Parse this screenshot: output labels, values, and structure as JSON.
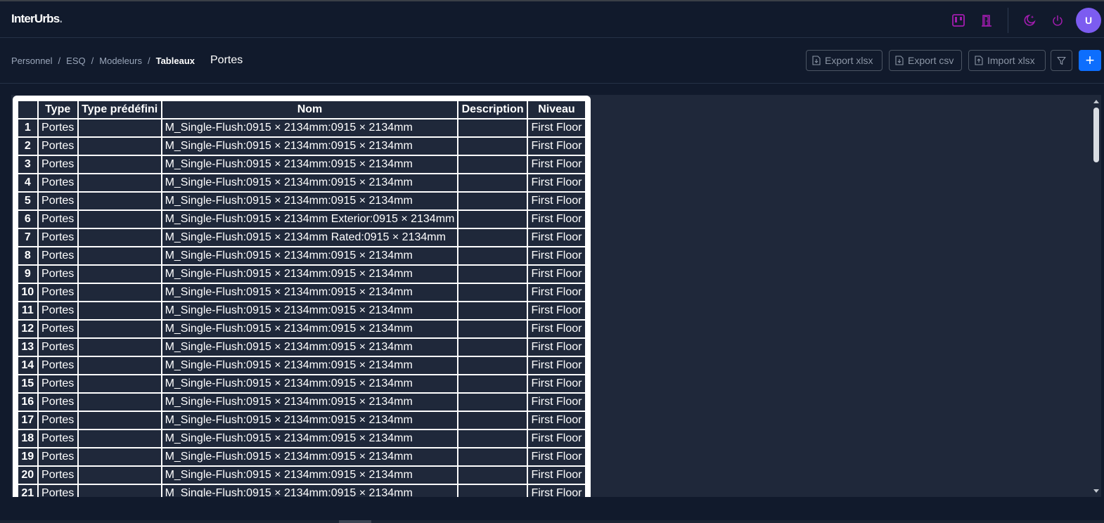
{
  "app": {
    "logo_main": "InterUrbs",
    "logo_dot": "."
  },
  "navbar": {
    "icons": [
      "kanban-icon",
      "door-icon",
      "moon-star-icon",
      "power-icon"
    ],
    "avatar_initial": "U",
    "accent_color": "#a21caf",
    "avatar_color": "#7c5cf0"
  },
  "breadcrumb": {
    "items": [
      "Personnel",
      "ESQ",
      "Modeleurs"
    ],
    "current": "Tableaux"
  },
  "page": {
    "title": "Portes"
  },
  "toolbar": {
    "export_xlsx": "Export xlsx",
    "export_csv": "Export csv",
    "import_xlsx": "Import xlsx",
    "add_label": "+"
  },
  "table": {
    "columns": [
      "",
      "Type",
      "Type prédéfini",
      "Nom",
      "Description",
      "Niveau"
    ],
    "rows": [
      [
        "1",
        "Portes",
        "",
        "M_Single-Flush:0915 × 2134mm:0915 × 2134mm",
        "",
        "First Floor"
      ],
      [
        "2",
        "Portes",
        "",
        "M_Single-Flush:0915 × 2134mm:0915 × 2134mm",
        "",
        "First Floor"
      ],
      [
        "3",
        "Portes",
        "",
        "M_Single-Flush:0915 × 2134mm:0915 × 2134mm",
        "",
        "First Floor"
      ],
      [
        "4",
        "Portes",
        "",
        "M_Single-Flush:0915 × 2134mm:0915 × 2134mm",
        "",
        "First Floor"
      ],
      [
        "5",
        "Portes",
        "",
        "M_Single-Flush:0915 × 2134mm:0915 × 2134mm",
        "",
        "First Floor"
      ],
      [
        "6",
        "Portes",
        "",
        "M_Single-Flush:0915 × 2134mm Exterior:0915 × 2134mm",
        "",
        "First Floor"
      ],
      [
        "7",
        "Portes",
        "",
        "M_Single-Flush:0915 × 2134mm Rated:0915 × 2134mm",
        "",
        "First Floor"
      ],
      [
        "8",
        "Portes",
        "",
        "M_Single-Flush:0915 × 2134mm:0915 × 2134mm",
        "",
        "First Floor"
      ],
      [
        "9",
        "Portes",
        "",
        "M_Single-Flush:0915 × 2134mm:0915 × 2134mm",
        "",
        "First Floor"
      ],
      [
        "10",
        "Portes",
        "",
        "M_Single-Flush:0915 × 2134mm:0915 × 2134mm",
        "",
        "First Floor"
      ],
      [
        "11",
        "Portes",
        "",
        "M_Single-Flush:0915 × 2134mm:0915 × 2134mm",
        "",
        "First Floor"
      ],
      [
        "12",
        "Portes",
        "",
        "M_Single-Flush:0915 × 2134mm:0915 × 2134mm",
        "",
        "First Floor"
      ],
      [
        "13",
        "Portes",
        "",
        "M_Single-Flush:0915 × 2134mm:0915 × 2134mm",
        "",
        "First Floor"
      ],
      [
        "14",
        "Portes",
        "",
        "M_Single-Flush:0915 × 2134mm:0915 × 2134mm",
        "",
        "First Floor"
      ],
      [
        "15",
        "Portes",
        "",
        "M_Single-Flush:0915 × 2134mm:0915 × 2134mm",
        "",
        "First Floor"
      ],
      [
        "16",
        "Portes",
        "",
        "M_Single-Flush:0915 × 2134mm:0915 × 2134mm",
        "",
        "First Floor"
      ],
      [
        "17",
        "Portes",
        "",
        "M_Single-Flush:0915 × 2134mm:0915 × 2134mm",
        "",
        "First Floor"
      ],
      [
        "18",
        "Portes",
        "",
        "M_Single-Flush:0915 × 2134mm:0915 × 2134mm",
        "",
        "First Floor"
      ],
      [
        "19",
        "Portes",
        "",
        "M_Single-Flush:0915 × 2134mm:0915 × 2134mm",
        "",
        "First Floor"
      ],
      [
        "20",
        "Portes",
        "",
        "M_Single-Flush:0915 × 2134mm:0915 × 2134mm",
        "",
        "First Floor"
      ],
      [
        "21",
        "Portes",
        "",
        "M_Single-Flush:0915 × 2134mm:0915 × 2134mm",
        "",
        "First Floor"
      ]
    ]
  }
}
